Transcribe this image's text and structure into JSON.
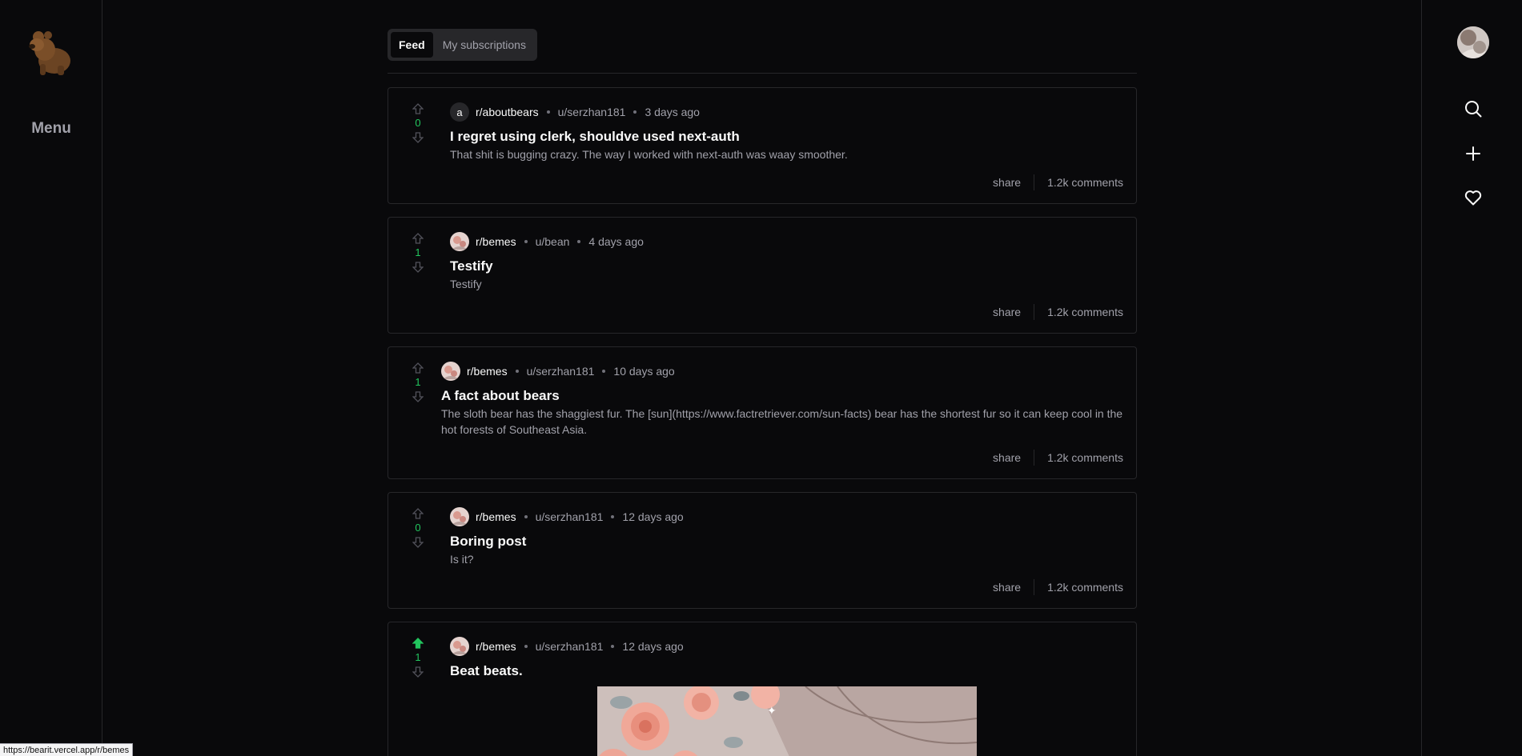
{
  "sidebar": {
    "menu_label": "Menu"
  },
  "tabs": [
    {
      "label": "Feed",
      "active": true
    },
    {
      "label": "My subscriptions",
      "active": false
    }
  ],
  "posts": [
    {
      "votes": "0",
      "subreddit_initial": "a",
      "subreddit": "r/aboutbears",
      "author": "u/serzhan181",
      "time": "3 days ago",
      "title": "I regret using clerk, shouldve used next-auth",
      "excerpt": "That shit is bugging crazy. The way I worked with next-auth was waay smoother.",
      "share": "share",
      "comments": "1.2k comments",
      "upvoted": false
    },
    {
      "votes": "1",
      "subreddit": "r/bemes",
      "author": "u/bean",
      "time": "4 days ago",
      "title": "Testify",
      "excerpt": "Testify",
      "share": "share",
      "comments": "1.2k comments",
      "upvoted": false
    },
    {
      "votes": "1",
      "subreddit": "r/bemes",
      "author": "u/serzhan181",
      "time": "10 days ago",
      "title": "A fact about bears",
      "excerpt": "The sloth bear has the shaggiest fur. The [sun](https://www.factretriever.com/sun-facts) bear has the shortest fur so it can keep cool in the hot forests of Southeast Asia.",
      "share": "share",
      "comments": "1.2k comments",
      "upvoted": false
    },
    {
      "votes": "0",
      "subreddit": "r/bemes",
      "author": "u/serzhan181",
      "time": "12 days ago",
      "title": "Boring post",
      "excerpt": "Is it?",
      "share": "share",
      "comments": "1.2k comments",
      "upvoted": false
    },
    {
      "votes": "1",
      "subreddit": "r/bemes",
      "author": "u/serzhan181",
      "time": "12 days ago",
      "title": "Beat beats.",
      "upvoted": true
    }
  ],
  "status_url": "https://bearit.vercel.app/r/bemes",
  "colors": {
    "accent": "#22c55e",
    "background": "#09090b",
    "border": "#27272a",
    "muted": "#a1a1aa"
  },
  "icons": [
    "bear-logo-icon",
    "search-icon",
    "plus-icon",
    "heart-icon",
    "upvote-icon",
    "downvote-icon"
  ]
}
